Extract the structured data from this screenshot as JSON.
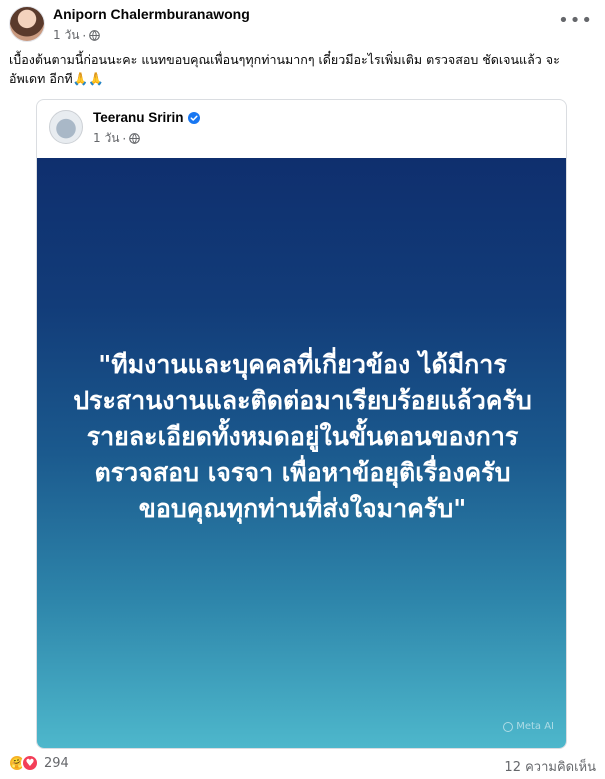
{
  "post": {
    "author": "Aniporn Chalermburanawong",
    "time": "1 วัน",
    "privacy_icon": "globe-icon",
    "caption": "เบื้องต้นตามนี้ก่อนนะคะ แนทขอบคุณเพื่อนๆทุกท่านมากๆ  เดี๋ยวมีอะไรเพิ่มเติม ตรวจสอบ ชัดเจนแล้ว  จะอัพเดท อีกที🙏🙏"
  },
  "shared": {
    "author": "Teeranu Sririn",
    "time": "1 วัน",
    "verified_color": "#1877f2",
    "text_lines": [
      "\"ทีมงานและบุคคลที่เกี่ยวข้อง ได้มีการ",
      "ประสานงานและติดต่อมาเรียบร้อยแล้วครับ",
      "รายละเอียดทั้งหมดอยู่ในขั้นตอนของการ",
      "ตรวจสอบ เจรจา เพื่อหาข้อยุติเรื่องครับ",
      "ขอบคุณทุกท่านที่ส่งใจมาครับ\""
    ],
    "watermark": "Meta AI"
  },
  "footer": {
    "reaction_count": "294",
    "comments": "12 ความคิดเห็น"
  },
  "colors": {
    "accent": "#1877f2",
    "secondary_text": "#65676b",
    "card_gradient_top": "#0f2f6e",
    "card_gradient_bottom": "#4eb8cc"
  }
}
